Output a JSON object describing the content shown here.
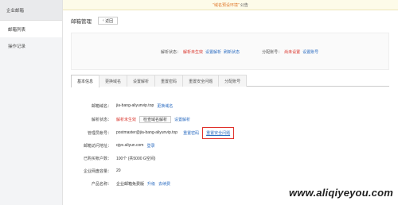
{
  "sidebar": {
    "title": "企业邮箱",
    "items": [
      {
        "label": "邮箱列表"
      },
      {
        "label": "操作记录"
      }
    ]
  },
  "notice": {
    "text": "\"域名预设环境\"",
    "suffix": "公告"
  },
  "header": {
    "title": "邮箱管理",
    "back_label": "返回"
  },
  "status": {
    "parse_label": "解析状态：",
    "parse_value": "解析未生效",
    "set_parse": "设置解析",
    "refresh_status": "刷新状态",
    "assign_label": "分配账号：",
    "assign_value": "尚未设置",
    "set_account": "设置账号"
  },
  "tabs": [
    {
      "label": "基本信息",
      "active": true
    },
    {
      "label": "更换域名"
    },
    {
      "label": "设置解析"
    },
    {
      "label": "重置密码"
    },
    {
      "label": "重置安全问题"
    },
    {
      "label": "分配账号"
    }
  ],
  "info": {
    "domain": {
      "label": "邮箱域名：",
      "value": "jia-bang-aliyunvip.top",
      "action": "更换域名"
    },
    "parse": {
      "label": "解析状态：",
      "value": "解析未生效",
      "check_btn": "检查域名解析",
      "set_link": "设置解析"
    },
    "admin": {
      "label": "管理员帐号：",
      "value": "postmaster@jia-bang-aliyunvip.top",
      "reset_pwd": "重置密码",
      "reset_security": "重置安全问题"
    },
    "login": {
      "label": "邮箱访问地址：",
      "value": "qiye.aliyun.com",
      "action": "登录"
    },
    "accounts": {
      "label": "已购买帐户数：",
      "value": "100个 (共5000 G空间)"
    },
    "capacity": {
      "label": "企业网盘容量：",
      "value": "20"
    },
    "product": {
      "label": "产品名称：",
      "value": "企业邮箱免费版",
      "upgrade": "升级",
      "renew": "去续费"
    }
  },
  "watermark": "www.aliqiyeyou.com"
}
